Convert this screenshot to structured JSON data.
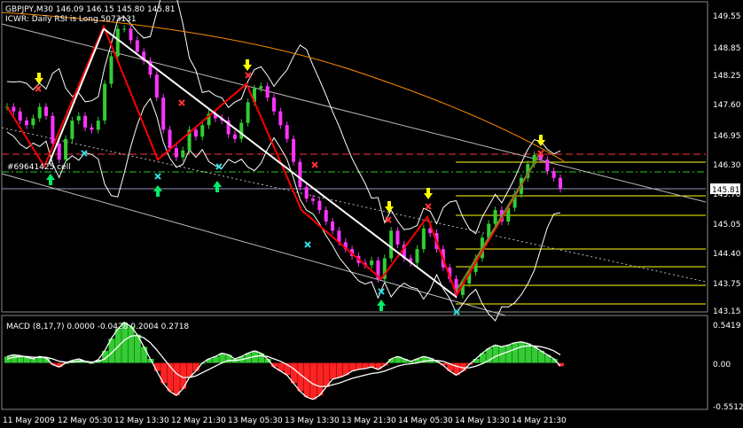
{
  "header": {
    "symbol_line": "GBPJPY,M30  146.09 146.15 145.80 145.81",
    "indicator_line": "ICWR: Daily RSI is Long 5073131"
  },
  "annotations": {
    "cell_label": "#69641425 cell"
  },
  "price_panel": {
    "y_ticks": [
      "149.55",
      "148.85",
      "148.25",
      "147.60",
      "146.95",
      "146.30",
      "145.70",
      "145.05",
      "144.40",
      "143.75",
      "143.15"
    ],
    "current_price": "145.81"
  },
  "macd_panel": {
    "label": "MACD (8,17,7) 0.0000 -0.0428 0.2004 0.2718",
    "y_ticks": [
      "0.5419",
      "0.00",
      "-0.5512"
    ]
  },
  "x_ticks": [
    "11 May 2009",
    "12 May 05:30",
    "12 May 13:30",
    "12 May 21:30",
    "13 May 05:30",
    "13 May 13:30",
    "13 May 21:30",
    "14 May 05:30",
    "14 May 13:30",
    "14 May 21:30"
  ],
  "colors": {
    "background": "#000000",
    "bull_candle": "#33cc33",
    "bear_candle": "#ff33ff",
    "zigzag": "#ff0000",
    "trendline": "#ffffff",
    "bands": "#ffffff",
    "long_ma": "#ff8c00",
    "fib_levels": "#ffff00",
    "resistance_dash": "#ff3333",
    "support_dash": "#22cc22",
    "macd_positive": "#33cc33",
    "macd_negative": "#ff2222",
    "arrow_down": "#ffff00",
    "arrow_up": "#00ee66",
    "cross_marker": "#ff3333",
    "x_marker": "#33dddd"
  },
  "chart_data": [
    {
      "type": "candlestick",
      "title": "GBPJPY,M30",
      "ylim": [
        143.15,
        149.85
      ],
      "series": [
        {
          "name": "GBPJPY,M30",
          "values": [
            147.6,
            147.5,
            147.3,
            147.2,
            147.35,
            147.6,
            147.4,
            146.8,
            146.45,
            146.9,
            147.3,
            147.4,
            147.15,
            147.1,
            147.3,
            148.1,
            148.7,
            149.3,
            149.3,
            149.05,
            148.8,
            148.6,
            148.3,
            147.8,
            147.1,
            146.7,
            146.5,
            146.65,
            147.1,
            146.95,
            147.2,
            147.45,
            147.35,
            147.3,
            147.0,
            146.9,
            147.25,
            147.7,
            148.0,
            148.05,
            147.8,
            147.5,
            147.2,
            146.9,
            146.4,
            145.85,
            145.6,
            145.55,
            145.35,
            145.1,
            144.9,
            144.65,
            144.5,
            144.35,
            144.2,
            144.15,
            144.25,
            143.85,
            144.3,
            144.9,
            144.6,
            144.3,
            144.2,
            144.5,
            144.95,
            144.85,
            144.5,
            144.1,
            143.85,
            143.5,
            143.75,
            144.0,
            144.3,
            144.75,
            145.05,
            145.35,
            145.1,
            145.4,
            145.7,
            146.05,
            146.35,
            146.55,
            146.45,
            146.2,
            146.05,
            145.81
          ]
        }
      ]
    },
    {
      "type": "bar",
      "title": "MACD (8,17,7)",
      "ylim": [
        -0.5512,
        0.5419
      ],
      "series": [
        {
          "name": "MACD",
          "values": [
            0.08,
            0.1,
            0.09,
            0.07,
            0.05,
            0.08,
            0.06,
            -0.02,
            -0.05,
            0.0,
            0.03,
            0.05,
            0.02,
            0.0,
            0.04,
            0.15,
            0.3,
            0.42,
            0.5,
            0.45,
            0.35,
            0.2,
            0.05,
            -0.1,
            -0.25,
            -0.35,
            -0.4,
            -0.32,
            -0.18,
            -0.1,
            0.0,
            0.05,
            0.08,
            0.12,
            0.1,
            0.05,
            0.08,
            0.12,
            0.15,
            0.12,
            0.05,
            -0.05,
            -0.1,
            -0.15,
            -0.25,
            -0.35,
            -0.42,
            -0.45,
            -0.4,
            -0.3,
            -0.2,
            -0.18,
            -0.15,
            -0.1,
            -0.08,
            -0.07,
            -0.05,
            -0.08,
            -0.03,
            0.05,
            0.08,
            0.05,
            0.02,
            0.05,
            0.08,
            0.06,
            0.02,
            -0.03,
            -0.1,
            -0.15,
            -0.1,
            -0.02,
            0.05,
            0.12,
            0.18,
            0.22,
            0.2,
            0.22,
            0.25,
            0.26,
            0.24,
            0.2,
            0.15,
            0.1,
            0.05,
            -0.04
          ]
        },
        {
          "name": "Signal",
          "values": [
            0.05,
            0.07,
            0.08,
            0.08,
            0.07,
            0.07,
            0.07,
            0.05,
            0.02,
            0.01,
            0.01,
            0.02,
            0.02,
            0.01,
            0.02,
            0.05,
            0.12,
            0.2,
            0.28,
            0.33,
            0.34,
            0.31,
            0.25,
            0.16,
            0.06,
            -0.04,
            -0.13,
            -0.18,
            -0.18,
            -0.16,
            -0.12,
            -0.08,
            -0.04,
            0.0,
            0.03,
            0.03,
            0.04,
            0.06,
            0.08,
            0.09,
            0.08,
            0.05,
            0.02,
            -0.02,
            -0.07,
            -0.14,
            -0.2,
            -0.26,
            -0.29,
            -0.29,
            -0.27,
            -0.25,
            -0.22,
            -0.19,
            -0.17,
            -0.15,
            -0.13,
            -0.12,
            -0.1,
            -0.07,
            -0.04,
            -0.02,
            -0.01,
            0.0,
            0.02,
            0.03,
            0.03,
            0.02,
            -0.01,
            -0.04,
            -0.06,
            -0.06,
            -0.04,
            -0.01,
            0.03,
            0.08,
            0.11,
            0.14,
            0.17,
            0.2,
            0.21,
            0.21,
            0.2,
            0.18,
            0.15,
            0.1
          ]
        }
      ]
    }
  ]
}
